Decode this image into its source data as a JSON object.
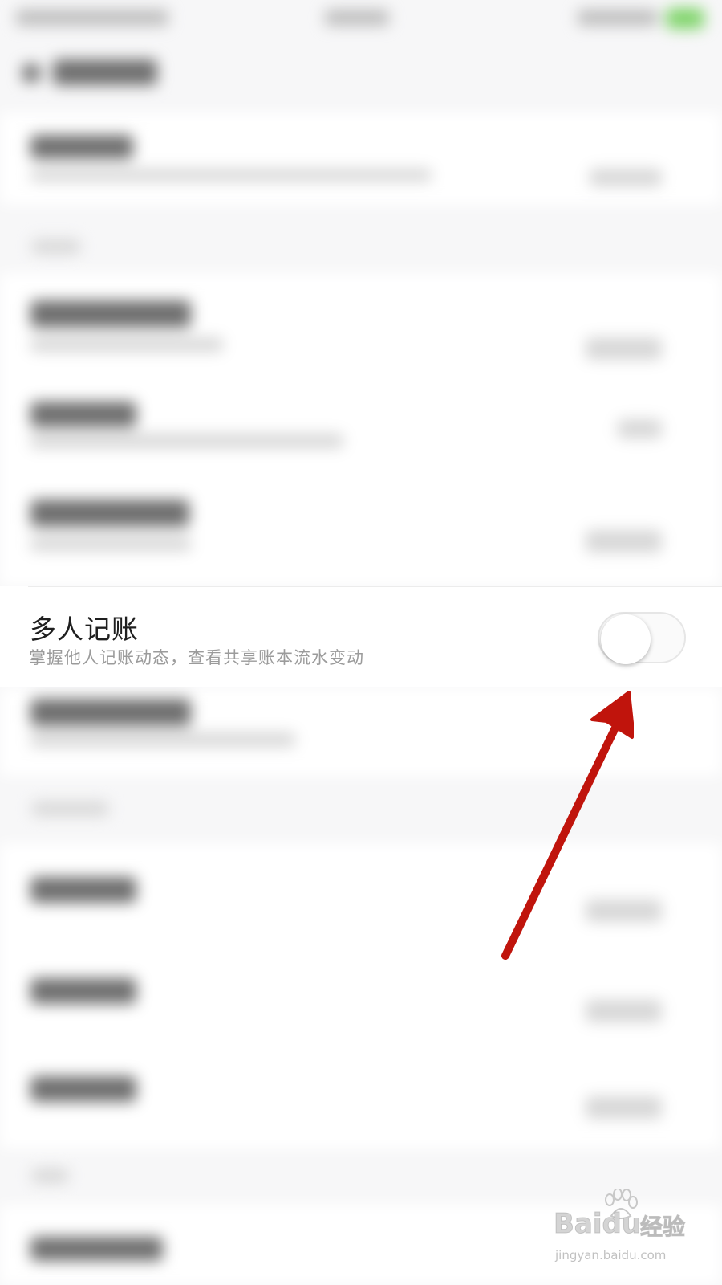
{
  "setting_row": {
    "title": "多人记账",
    "subtitle": "掌握他人记账动态，查看共享账本流水变动",
    "toggle_state": "off"
  },
  "annotation": {
    "type": "arrow",
    "color": "#c0140c"
  },
  "watermark": {
    "brand": "Baidu",
    "brand_cn": "经验",
    "url": "jingyan.baidu.com"
  }
}
